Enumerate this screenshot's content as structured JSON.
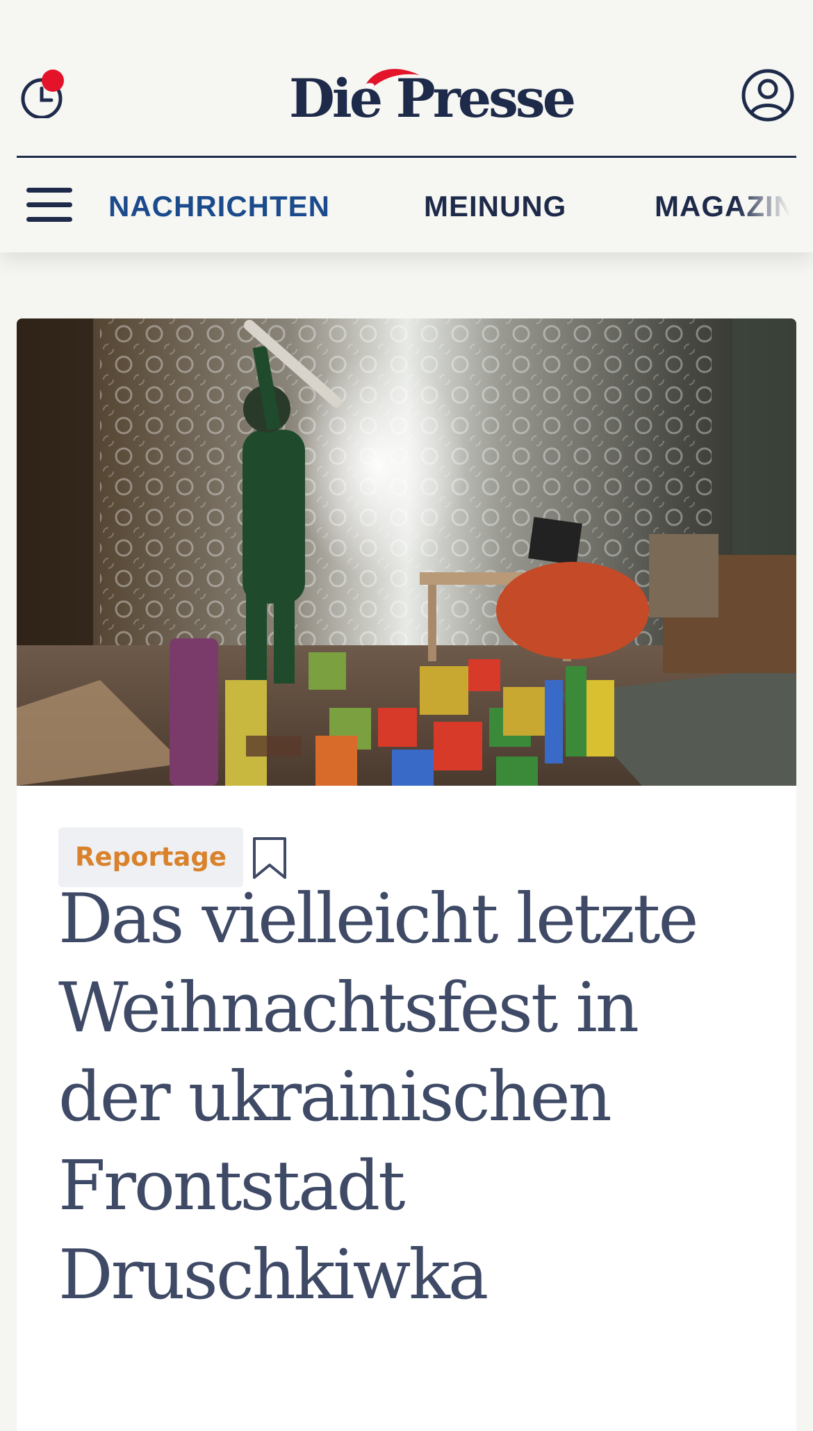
{
  "header": {
    "logo": "Die Presse",
    "history_icon": "history-clock-icon",
    "notification_badge": true,
    "account_icon": "user-account-icon",
    "brand_color": "#1e2a4a",
    "badge_color": "#e3132a"
  },
  "nav": {
    "menu_icon": "hamburger-menu-icon",
    "items": [
      {
        "label": "NACHRICHTEN",
        "active": true
      },
      {
        "label": "MEINUNG",
        "active": false
      },
      {
        "label": "MAGAZIN",
        "active": false
      }
    ],
    "active_color": "#1b4b8c"
  },
  "article": {
    "image_alt": "Kind mit Stock in einem Wohnzimmer voller Spielzeugbausteine",
    "tag": "Reportage",
    "tag_color": "#d9822b",
    "bookmark_icon": "bookmark-icon",
    "headline": "Das vielleicht letzte Weihnachtsfest in der ukrainischen Frontstadt Druschkiwka",
    "headline_color": "#3f4a66"
  }
}
